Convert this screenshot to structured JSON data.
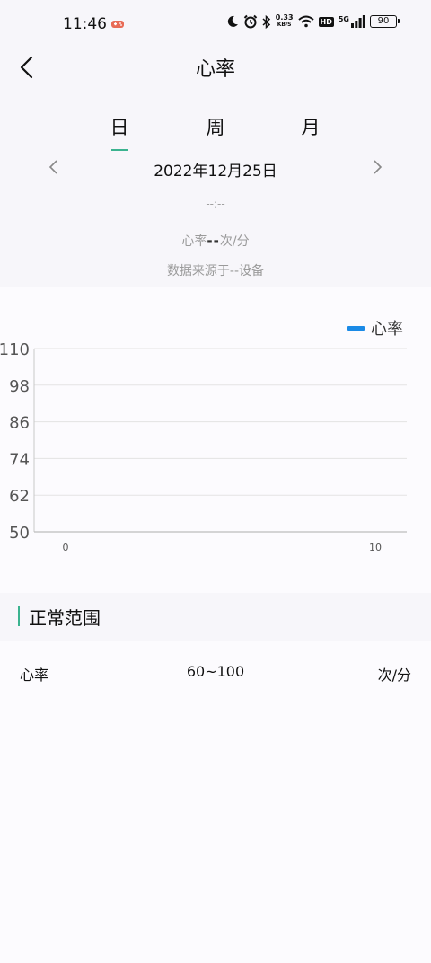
{
  "status_bar": {
    "time": "11:46",
    "net_speed_value": "0.33",
    "net_speed_unit": "KB/S",
    "hd": "HD",
    "signal_label": "5G",
    "battery": "90"
  },
  "header": {
    "title": "心率"
  },
  "tabs": [
    {
      "label": "日",
      "active": true
    },
    {
      "label": "周",
      "active": false
    },
    {
      "label": "月",
      "active": false
    }
  ],
  "date_nav": {
    "current_date": "2022年12月25日"
  },
  "summary": {
    "time_range": "--:--",
    "hr_label": "心率",
    "hr_value": "--",
    "hr_unit": "次/分",
    "source": "数据来源于--设备"
  },
  "chart_data": {
    "type": "line",
    "legend": [
      {
        "name": "心率",
        "color": "#1a8ae6"
      }
    ],
    "legend_position": "top-right",
    "x": [],
    "series": [
      {
        "name": "心率",
        "values": []
      }
    ],
    "xlim": [
      0,
      10
    ],
    "xticks": [
      "0",
      "10"
    ],
    "ylim": [
      50,
      110
    ],
    "yticks": [
      "110",
      "98",
      "86",
      "74",
      "62",
      "50"
    ],
    "grid": true
  },
  "normal_range": {
    "title": "正常范围",
    "rows": [
      {
        "name": "心率",
        "range": "60~100",
        "unit": "次/分"
      }
    ]
  },
  "colors": {
    "accent": "#3bb38f",
    "series": "#1a8ae6",
    "panel_bg": "#f7f6fa",
    "page_bg": "#fcfbfe"
  }
}
